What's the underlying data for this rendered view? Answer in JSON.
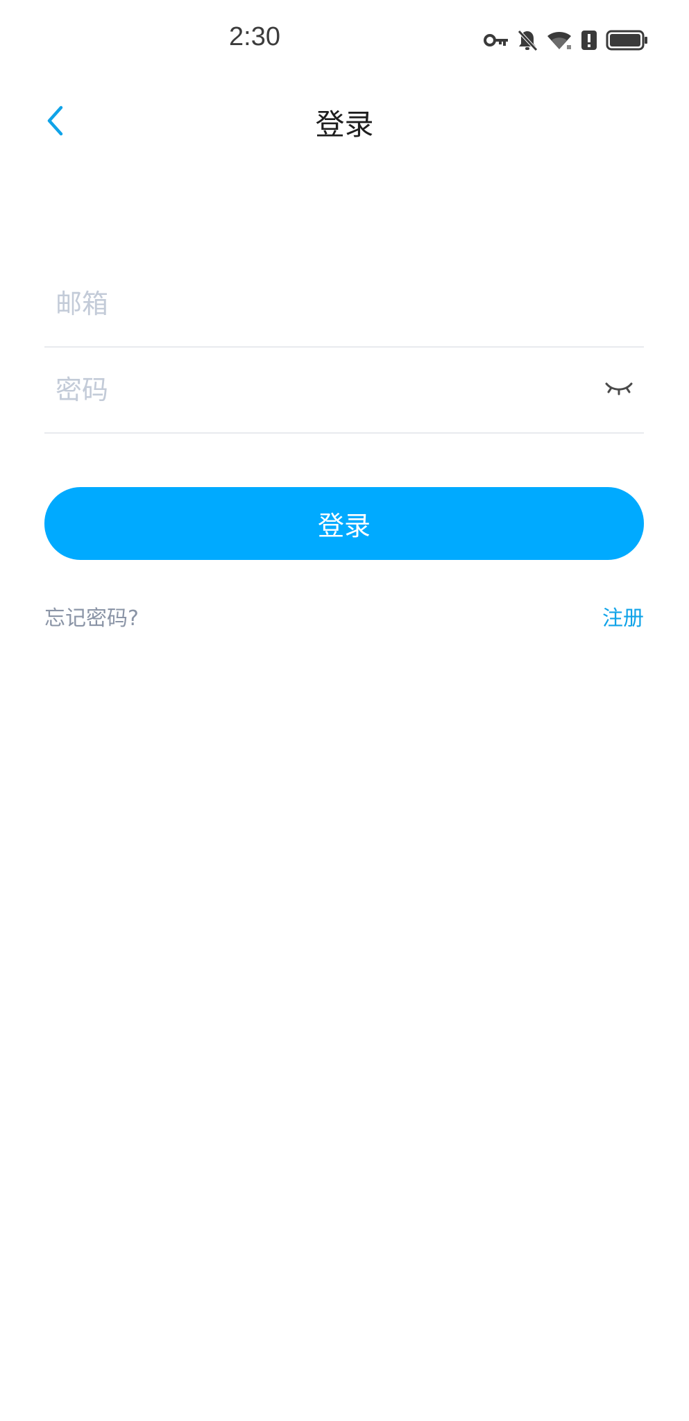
{
  "status_bar": {
    "time": "2:30",
    "icons": [
      "vpn-key-icon",
      "bell-off-icon",
      "wifi-icon",
      "alert-icon",
      "battery-icon"
    ]
  },
  "header": {
    "back_icon": "chevron-left-icon",
    "title": "登录"
  },
  "form": {
    "email": {
      "value": "",
      "placeholder": "邮箱"
    },
    "password": {
      "value": "",
      "placeholder": "密码",
      "toggle_icon": "eye-closed-icon"
    },
    "submit_label": "登录"
  },
  "links": {
    "forgot_password": "忘记密码?",
    "register": "注册"
  },
  "colors": {
    "accent": "#00aaff",
    "link": "#10a3e8",
    "placeholder": "#c3cbd8",
    "muted_text": "#8a94a6",
    "divider": "#e8eaee"
  }
}
